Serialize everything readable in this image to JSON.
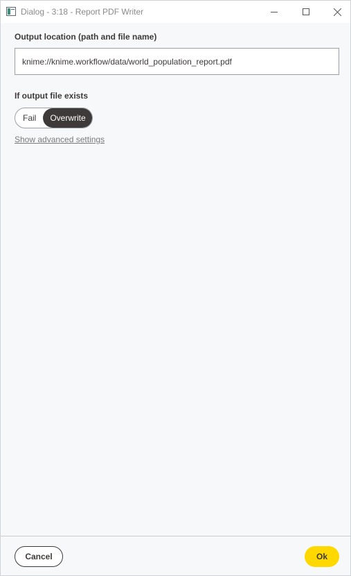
{
  "window": {
    "title": "Dialog - 3:18 - Report PDF Writer"
  },
  "output": {
    "label": "Output location (path and file name)",
    "path_value": "knime://knime.workflow/data/world_population_report.pdf"
  },
  "exists": {
    "label": "If output file exists",
    "options": [
      "Fail",
      "Overwrite"
    ],
    "selected": "Overwrite"
  },
  "advanced_link": "Show advanced settings",
  "footer": {
    "cancel_label": "Cancel",
    "ok_label": "Ok"
  },
  "colors": {
    "accent": "#ffd800",
    "dark": "#3e3a39",
    "background": "#f7f8fa"
  },
  "icons": {
    "app": "dialog-window-icon",
    "minimize": "minimize-icon",
    "maximize": "maximize-icon",
    "close": "close-icon"
  }
}
